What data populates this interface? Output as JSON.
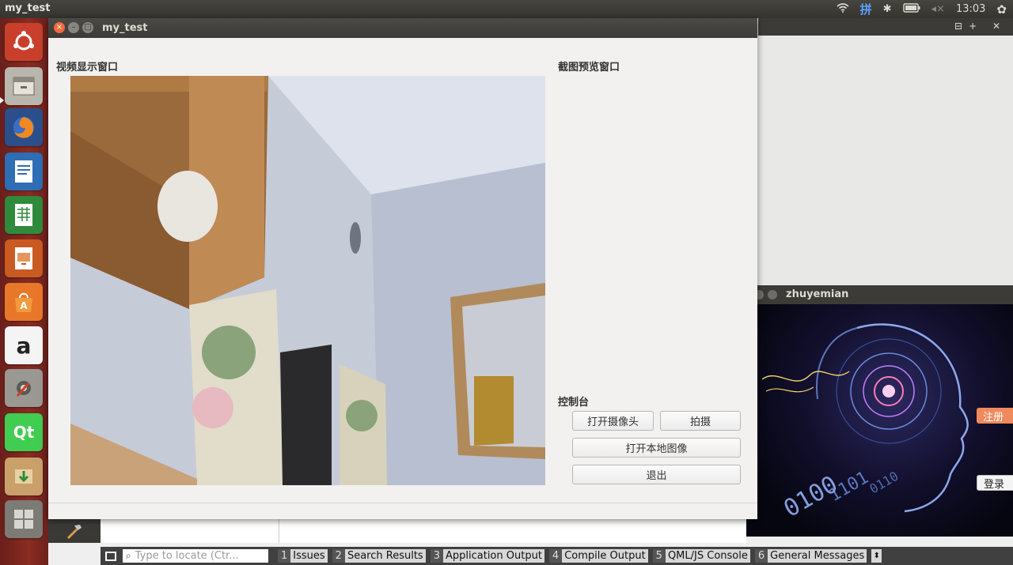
{
  "top_panel": {
    "app_title": "my_test",
    "ime": "拼",
    "bluetooth": "✱",
    "mute": "◂×",
    "time": "13:03",
    "gear": "✿"
  },
  "launcher": {
    "items": [
      "ubuntu-dash",
      "files",
      "firefox",
      "libreoffice-writer",
      "libreoffice-calc",
      "libreoffice-impress",
      "software-center",
      "amazon",
      "system-settings",
      "qt-creator",
      "update-manager",
      "workspace-switcher"
    ],
    "qt_label": "Qt",
    "amazon_label": "a"
  },
  "window": {
    "title": "my_test",
    "video_label": "视频显示窗口",
    "preview_label": "截图预览窗口",
    "console_label": "控制台",
    "buttons": {
      "open_camera": "打开摄像头",
      "capture": "拍摄",
      "open_local": "打开本地图像",
      "exit": "退出"
    }
  },
  "zhuyemian": {
    "title": "zhuyemian",
    "register": "注册",
    "login": "登录"
  },
  "right_bar": {
    "controls": "⊟+ ✕"
  },
  "bottom_bar": {
    "locate_icon": "⌕",
    "locate_placeholder": "Type to locate (Ctr...",
    "tabs": [
      {
        "num": "1",
        "label": "Issues"
      },
      {
        "num": "2",
        "label": "Search Results"
      },
      {
        "num": "3",
        "label": "Application Output"
      },
      {
        "num": "4",
        "label": "Compile Output"
      },
      {
        "num": "5",
        "label": "QML/JS Console"
      },
      {
        "num": "6",
        "label": "General Messages"
      }
    ],
    "more_arrow": "⬍"
  },
  "colors": {
    "launcher": "#8a2c22",
    "panel": "#3c3b37",
    "close": "#f2683c",
    "register": "#f08a5d"
  }
}
